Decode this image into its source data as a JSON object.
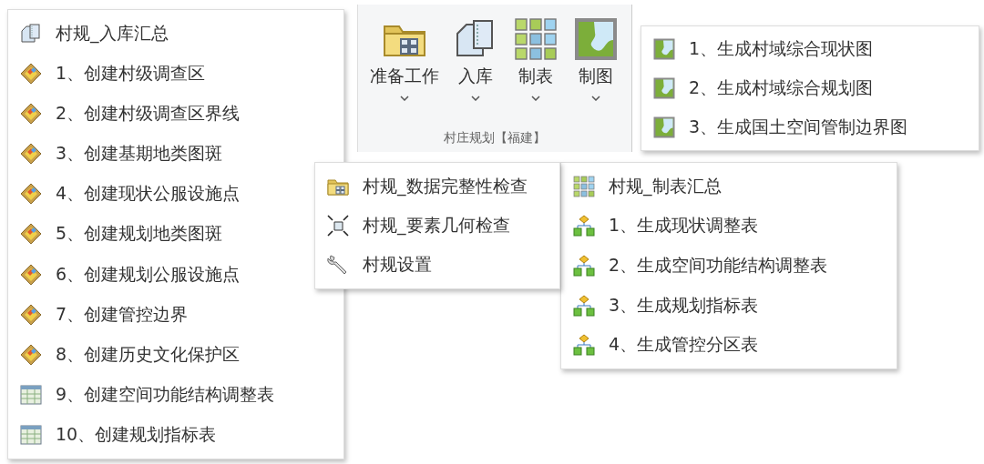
{
  "ribbon_group": {
    "title": "村庄规划【福建】",
    "buttons": [
      {
        "kind": "folder",
        "label": "准备工作"
      },
      {
        "kind": "stack",
        "label": "入库"
      },
      {
        "kind": "grid",
        "label": "制表"
      },
      {
        "kind": "map",
        "label": "制图"
      }
    ]
  },
  "menus": [
    {
      "items": [
        {
          "kind": "stack",
          "label": "村规_入库汇总"
        },
        {
          "kind": "diamond",
          "label": "1、创建村级调查区"
        },
        {
          "kind": "diamond",
          "label": "2、创建村级调查区界线"
        },
        {
          "kind": "diamond",
          "label": "3、创建基期地类图斑"
        },
        {
          "kind": "diamond",
          "label": "4、创建现状公服设施点"
        },
        {
          "kind": "diamond",
          "label": "5、创建规划地类图斑"
        },
        {
          "kind": "diamond",
          "label": "6、创建规划公服设施点"
        },
        {
          "kind": "diamond",
          "label": "7、创建管控边界"
        },
        {
          "kind": "diamond",
          "label": "8、创建历史文化保护区"
        },
        {
          "kind": "table",
          "label": "9、创建空间功能结构调整表"
        },
        {
          "kind": "table",
          "label": "10、创建规划指标表"
        }
      ]
    },
    {
      "items": [
        {
          "kind": "map",
          "label": "1、生成村域综合现状图"
        },
        {
          "kind": "map",
          "label": "2、生成村域综合规划图"
        },
        {
          "kind": "map",
          "label": "3、生成国土空间管制边界图"
        }
      ]
    },
    {
      "items": [
        {
          "kind": "folder",
          "label": "村规_数据完整性检查"
        },
        {
          "kind": "geometry",
          "label": "村规_要素几何检查"
        },
        {
          "kind": "wrench",
          "label": "村规设置"
        }
      ]
    },
    {
      "items": [
        {
          "kind": "grid",
          "label": "村规_制表汇总"
        },
        {
          "kind": "tree",
          "label": "1、生成现状调整表"
        },
        {
          "kind": "tree",
          "label": "2、生成空间功能结构调整表"
        },
        {
          "kind": "tree",
          "label": "3、生成规划指标表"
        },
        {
          "kind": "tree",
          "label": "4、生成管控分区表"
        }
      ]
    }
  ]
}
